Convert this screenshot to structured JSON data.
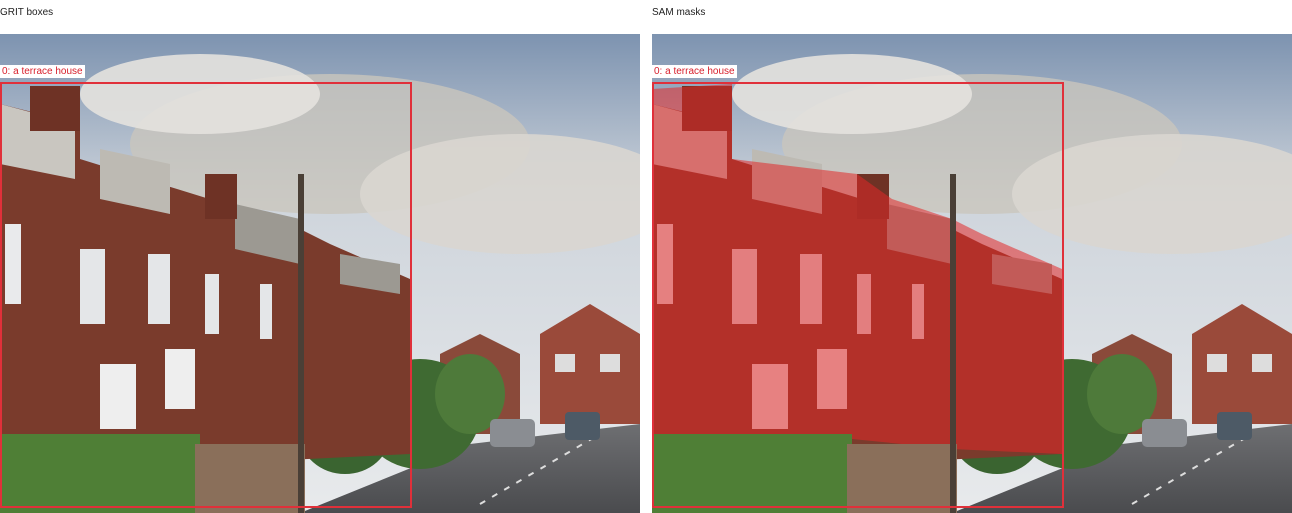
{
  "panels": {
    "left": {
      "title": "GRIT boxes",
      "label": "0: a terrace house"
    },
    "right": {
      "title": "SAM masks",
      "label": "0: a terrace house"
    }
  },
  "colors": {
    "box": "#e0303a",
    "mask": "rgba(225,40,40,0.55)"
  }
}
